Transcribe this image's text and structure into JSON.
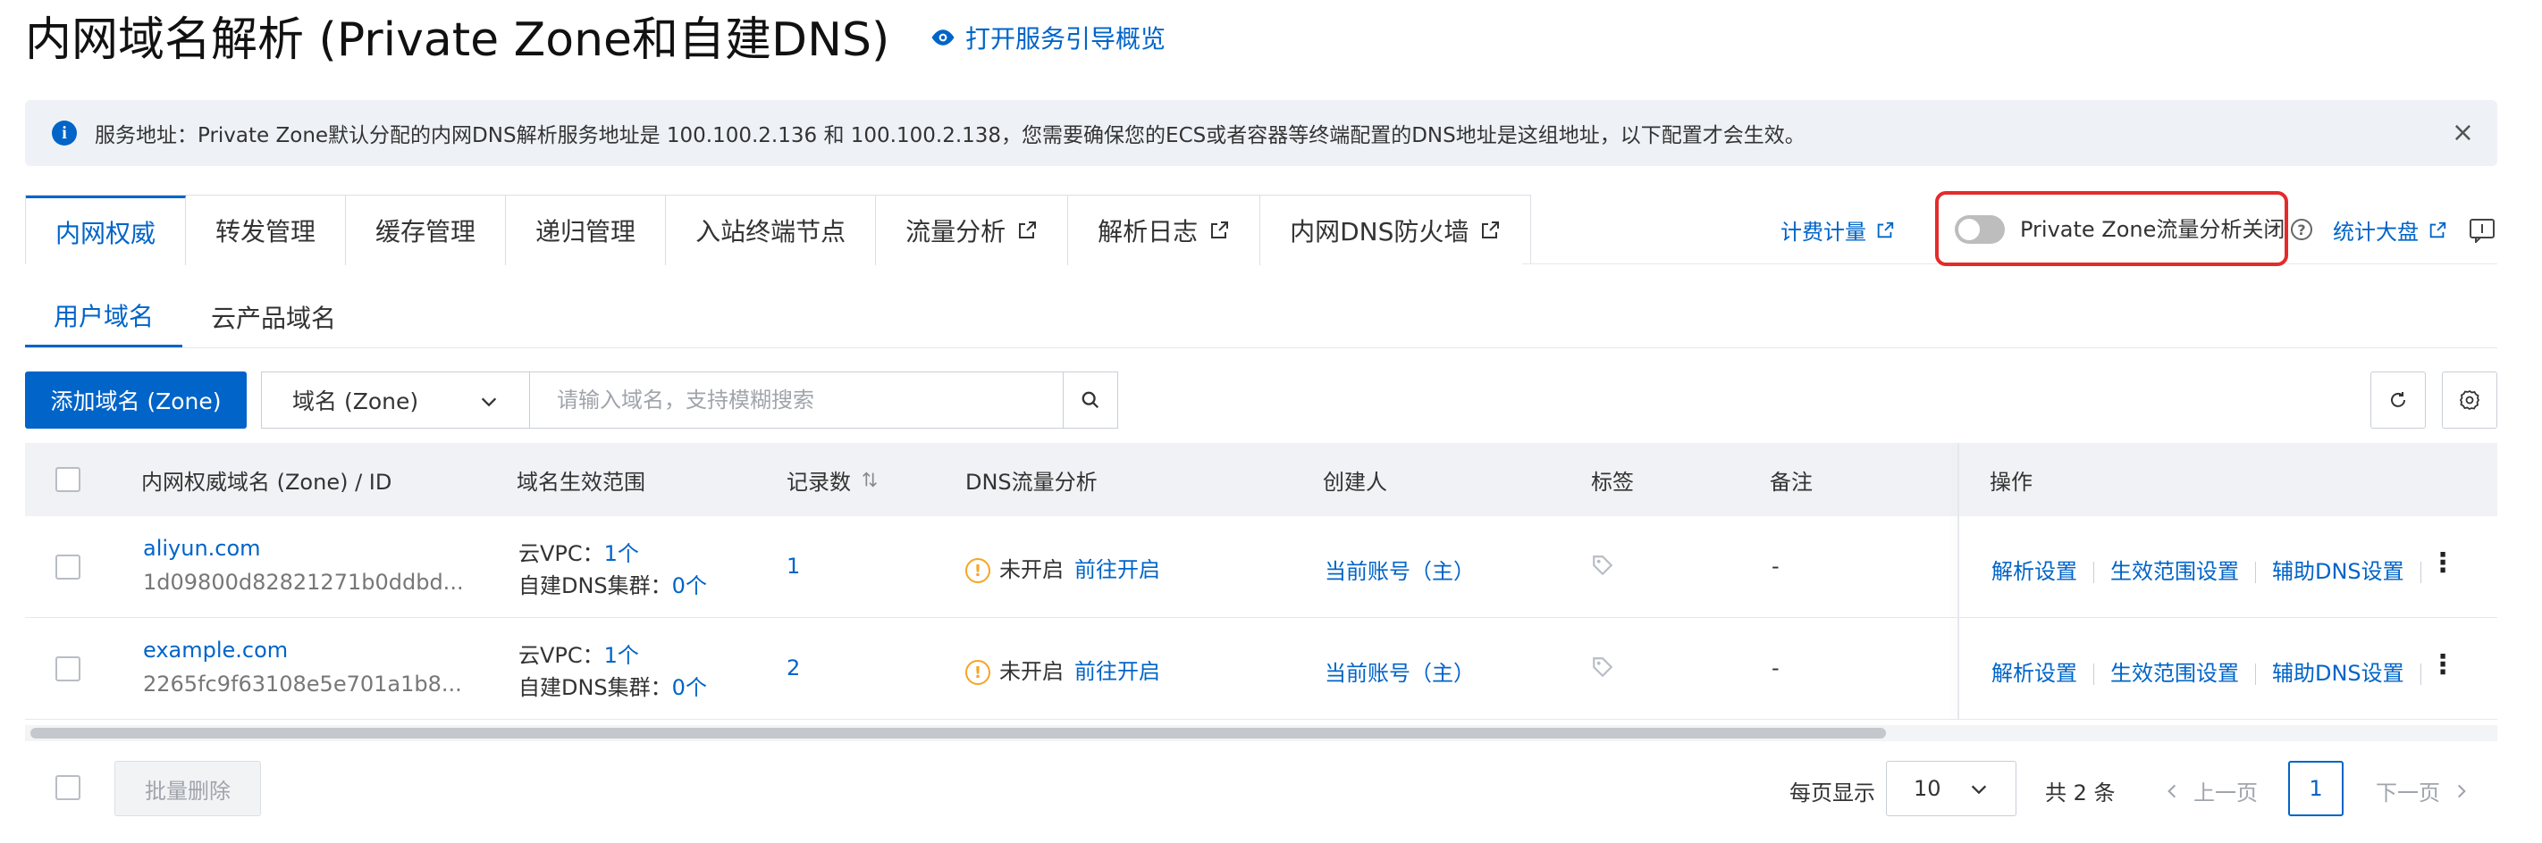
{
  "page_title": "内网域名解析 (Private Zone和自建DNS)",
  "guide_link": "打开服务引导概览",
  "banner": {
    "text": "服务地址：Private Zone默认分配的内网DNS解析服务地址是 100.100.2.136 和 100.100.2.138，您需要确保您的ECS或者容器等终端配置的DNS地址是这组地址，以下配置才会生效。",
    "close": "×"
  },
  "main_tabs": [
    {
      "label": "内网权威",
      "external": false
    },
    {
      "label": "转发管理",
      "external": false
    },
    {
      "label": "缓存管理",
      "external": false
    },
    {
      "label": "递归管理",
      "external": false
    },
    {
      "label": "入站终端节点",
      "external": false
    },
    {
      "label": "流量分析",
      "external": true
    },
    {
      "label": "解析日志",
      "external": true
    },
    {
      "label": "内网DNS防火墙",
      "external": true
    }
  ],
  "header_right": {
    "billing": "计费计量",
    "traffic_toggle_label": "Private Zone流量分析关闭",
    "traffic_toggle_on": false,
    "stats": "统计大盘"
  },
  "sub_tabs": [
    "用户域名",
    "云产品域名"
  ],
  "toolbar": {
    "add_button": "添加域名 (Zone)",
    "filter_value": "域名 (Zone)",
    "search_placeholder": "请输入域名，支持模糊搜索"
  },
  "table": {
    "headers": {
      "zone": "内网权威域名 (Zone) / ID",
      "scope": "域名生效范围",
      "records": "记录数",
      "dns_analysis": "DNS流量分析",
      "creator": "创建人",
      "tags": "标签",
      "remark": "备注",
      "actions": "操作"
    },
    "rows": [
      {
        "zone": "aliyun.com",
        "id": "1d09800d82821271b0ddbd...",
        "vpc_label": "云VPC：",
        "vpc_count": "1个",
        "dns_label": "自建DNS集群：",
        "dns_count": "0个",
        "records": "1",
        "analysis_status": "未开启",
        "analysis_link": "前往开启",
        "creator": "当前账号（主）",
        "remark": "-",
        "actions": [
          "解析设置",
          "生效范围设置",
          "辅助DNS设置"
        ]
      },
      {
        "zone": "example.com",
        "id": "2265fc9f63108e5e701a1b8...",
        "vpc_label": "云VPC：",
        "vpc_count": "1个",
        "dns_label": "自建DNS集群：",
        "dns_count": "0个",
        "records": "2",
        "analysis_status": "未开启",
        "analysis_link": "前往开启",
        "creator": "当前账号（主）",
        "remark": "-",
        "actions": [
          "解析设置",
          "生效范围设置",
          "辅助DNS设置"
        ]
      }
    ]
  },
  "footer": {
    "batch_delete": "批量删除",
    "per_page_label": "每页显示",
    "per_page_value": "10",
    "total": "共 2 条",
    "prev": "上一页",
    "current_page": "1",
    "next": "下一页"
  },
  "colors": {
    "primary": "#0064c8",
    "warning": "#f5a623",
    "highlight_border": "#e32b2b"
  }
}
